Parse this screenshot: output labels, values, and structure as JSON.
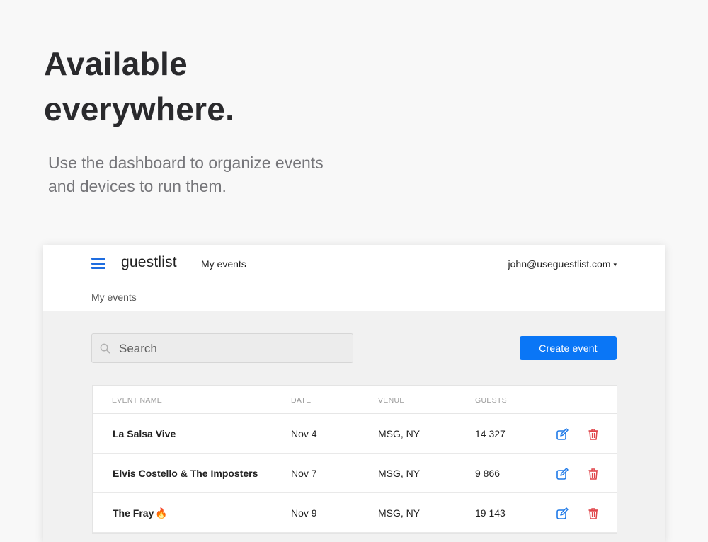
{
  "hero": {
    "headline_line1": "Available",
    "headline_line2": "everywhere.",
    "subline_line1": "Use the dashboard to organize events",
    "subline_line2": "and devices to run them."
  },
  "app": {
    "brand": "guestlist",
    "nav_my_events": "My events",
    "user_email": "john@useguestlist.com",
    "user_caret": "▾",
    "breadcrumb": "My events",
    "search": {
      "placeholder": "Search",
      "value": ""
    },
    "create_button": "Create event",
    "accent_color": "#0a76f6",
    "delete_color": "#e0454a",
    "table": {
      "headers": [
        "EVENT NAME",
        "DATE",
        "VENUE",
        "GUESTS"
      ],
      "rows": [
        {
          "name": "La Salsa Vive",
          "date": "Nov 4",
          "venue": "MSG, NY",
          "guests": "14 327"
        },
        {
          "name": "Elvis Costello & The Imposters",
          "date": "Nov 7",
          "venue": "MSG, NY",
          "guests": "9 866"
        },
        {
          "name": "The Fray",
          "emoji": "🔥",
          "date": "Nov 9",
          "venue": "MSG, NY",
          "guests": "19 143"
        }
      ]
    }
  }
}
